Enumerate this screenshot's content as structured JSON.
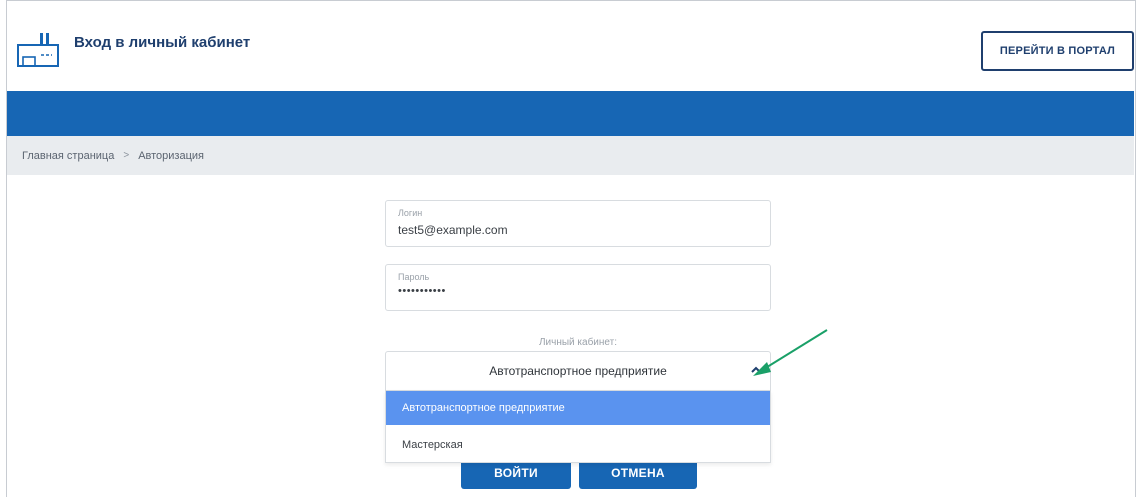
{
  "header": {
    "title": "Вход в личный кабинет",
    "portal_button": "ПЕРЕЙТИ В ПОРТАЛ",
    "logo_icon": "factory-icon"
  },
  "breadcrumb": {
    "home": "Главная страница",
    "separator": ">",
    "current": "Авторизация"
  },
  "form": {
    "login": {
      "label": "Логин",
      "value": "test5@example.com"
    },
    "password": {
      "label": "Пароль",
      "value": "•••••••••••"
    },
    "cabinet": {
      "label": "Личный кабинет:",
      "selected": "Автотранспортное предприятие",
      "options": [
        "Автотранспортное предприятие",
        "Мастерская"
      ]
    },
    "submit": "ВОЙТИ",
    "cancel": "ОТМЕНА"
  },
  "colors": {
    "brand_blue": "#1766b4",
    "navy": "#1f3f6e",
    "dropdown_highlight": "#5a93ef",
    "annotation_arrow": "#1aa068"
  }
}
